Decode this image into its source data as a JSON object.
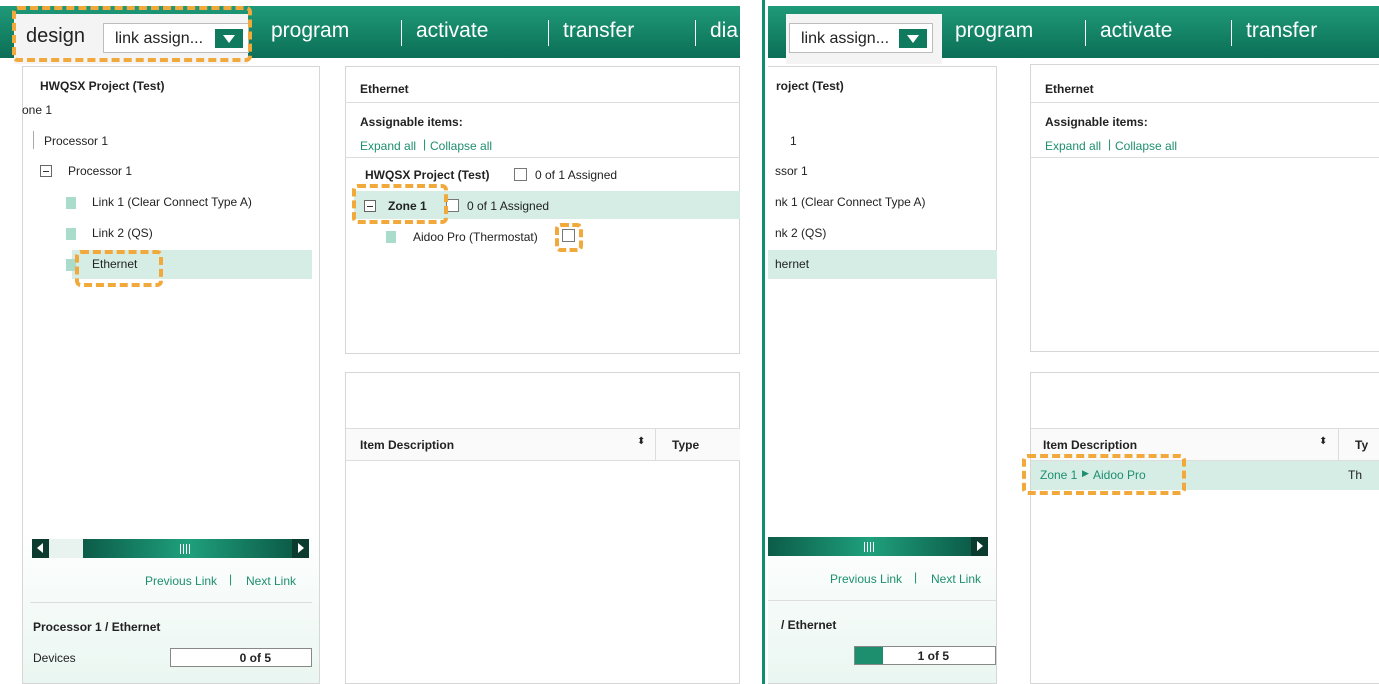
{
  "topnav": {
    "design": "design",
    "dropdown": "link assign...",
    "program": "program",
    "activate": "activate",
    "transfer": "transfer",
    "diag": "dia"
  },
  "tree": {
    "project": "HWQSX Project (Test)",
    "zone": "one 1",
    "proc_a": "Processor 1",
    "proc_b": "Processor 1",
    "link1": "Link 1 (Clear Connect Type A)",
    "link2": "Link 2 (QS)",
    "ethernet": "Ethernet"
  },
  "tree_r": {
    "project": "roject (Test)",
    "zone": "1",
    "proc": "ssor 1",
    "link1": "nk 1 (Clear Connect Type A)",
    "link2": "nk 2 (QS)",
    "ethernet": "hernet"
  },
  "links": {
    "prev": "Previous Link",
    "next": "Next Link"
  },
  "footer": {
    "title": "Processor 1 / Ethernet",
    "title_r": "/ Ethernet",
    "devices": "Devices",
    "count_left": "0 of 5",
    "count_right": "1 of 5"
  },
  "assign": {
    "title": "Ethernet",
    "assignable": "Assignable items:",
    "expand": "Expand all",
    "collapse": "Collapse all",
    "project": "HWQSX Project (Test)",
    "project_count": "0 of 1  Assigned",
    "zone": "Zone 1",
    "zone_count": "0 of 1  Assigned",
    "device": "Aidoo Pro (Thermostat)"
  },
  "table": {
    "col_desc": "Item Description",
    "col_type": "Type",
    "col_type_r": "Ty",
    "row_zone": "Zone 1",
    "row_device": "Aidoo Pro",
    "row_type": "Th"
  },
  "colors": {
    "accent": "#1e8f6e",
    "highlight": "#f2a93b",
    "selected_row": "#d5ede5"
  }
}
